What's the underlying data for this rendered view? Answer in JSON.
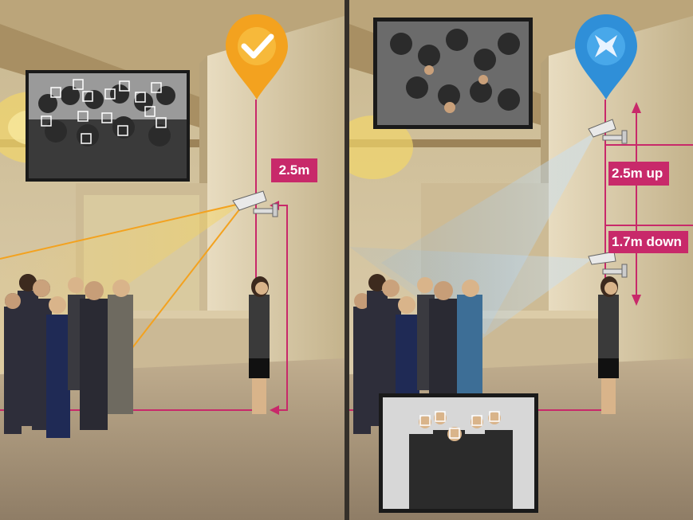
{
  "colors": {
    "accent_magenta": "#c8296a",
    "approve_orange": "#f3a21f",
    "brand_blue": "#2f8fd8",
    "wall": "#d8c8a6",
    "floor": "#b09c80"
  },
  "left_scene": {
    "marker_icon": "checkmark-icon",
    "height_label": "2.5m"
  },
  "right_scene": {
    "marker_icon": "brand-x-icon",
    "upper_label": "2.5m up",
    "lower_label": "1.7m down"
  }
}
